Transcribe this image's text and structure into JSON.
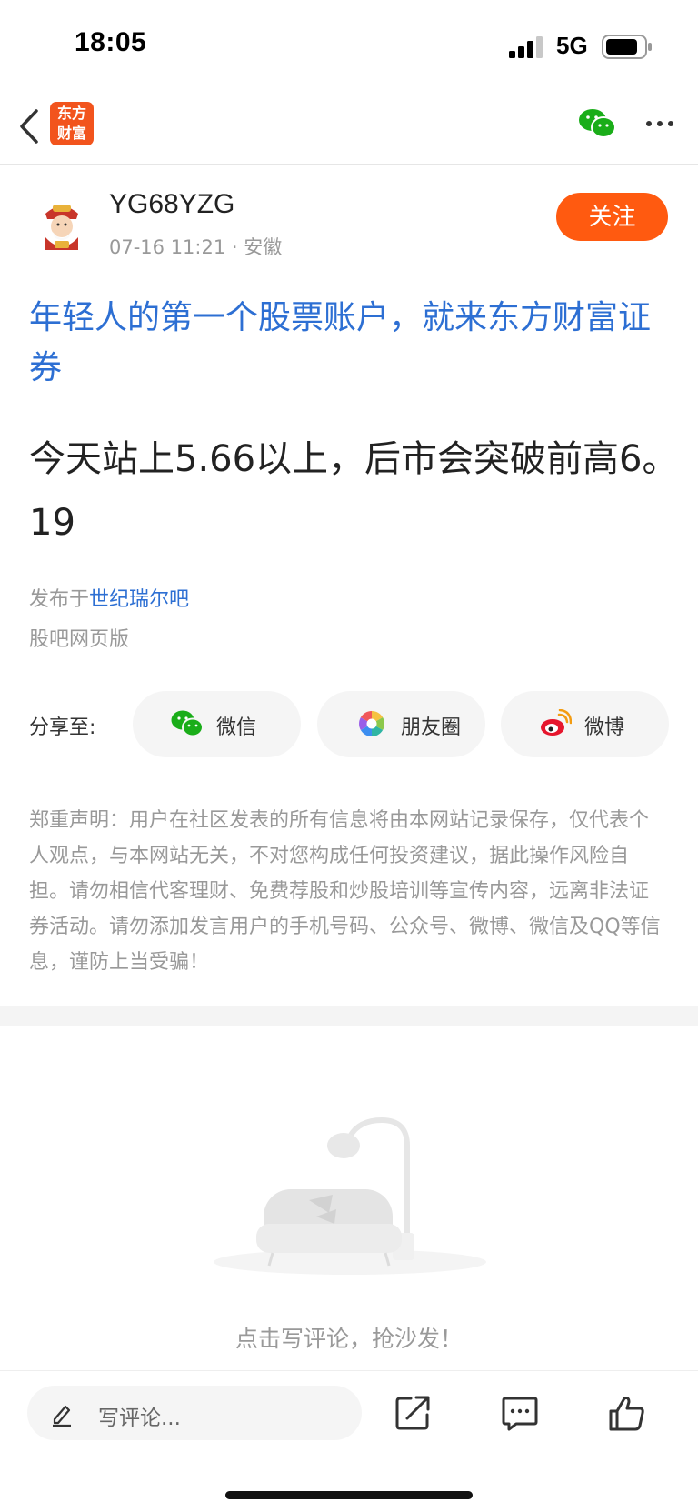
{
  "status_bar": {
    "time": "18:05",
    "network": "5G"
  },
  "nav": {
    "logo_line1": "东方",
    "logo_line2": "财富"
  },
  "post": {
    "author": "YG68YZG",
    "timestamp": "07-16 11:21",
    "location": "安徽",
    "follow_label": "关注",
    "headline": "年轻人的第一个股票账户，就来东方财富证券",
    "content": "今天站上5.66以上，后市会突破前高6。19",
    "origin_prefix": "发布于",
    "origin_forum": "世纪瑞尔吧",
    "web_version": "股吧网页版"
  },
  "share": {
    "label": "分享至:",
    "targets": [
      {
        "label": "微信",
        "icon": "wechat-icon"
      },
      {
        "label": "朋友圈",
        "icon": "moments-icon"
      },
      {
        "label": "微博",
        "icon": "weibo-icon"
      }
    ]
  },
  "disclaimer": "郑重声明：用户在社区发表的所有信息将由本网站记录保存，仅代表个人观点，与本网站无关，不对您构成任何投资建议，据此操作风险自担。请勿相信代客理财、免费荐股和炒股培训等宣传内容，远离非法证券活动。请勿添加发言用户的手机号码、公众号、微博、微信及QQ等信息，谨防上当受骗！",
  "comments": {
    "empty_text": "点击写评论，抢沙发！"
  },
  "bottom_bar": {
    "input_placeholder": "写评论..."
  },
  "colors": {
    "accent": "#ff5a10",
    "link": "#2d6fd3",
    "logo": "#f2541d",
    "wechat": "#1aad19"
  }
}
